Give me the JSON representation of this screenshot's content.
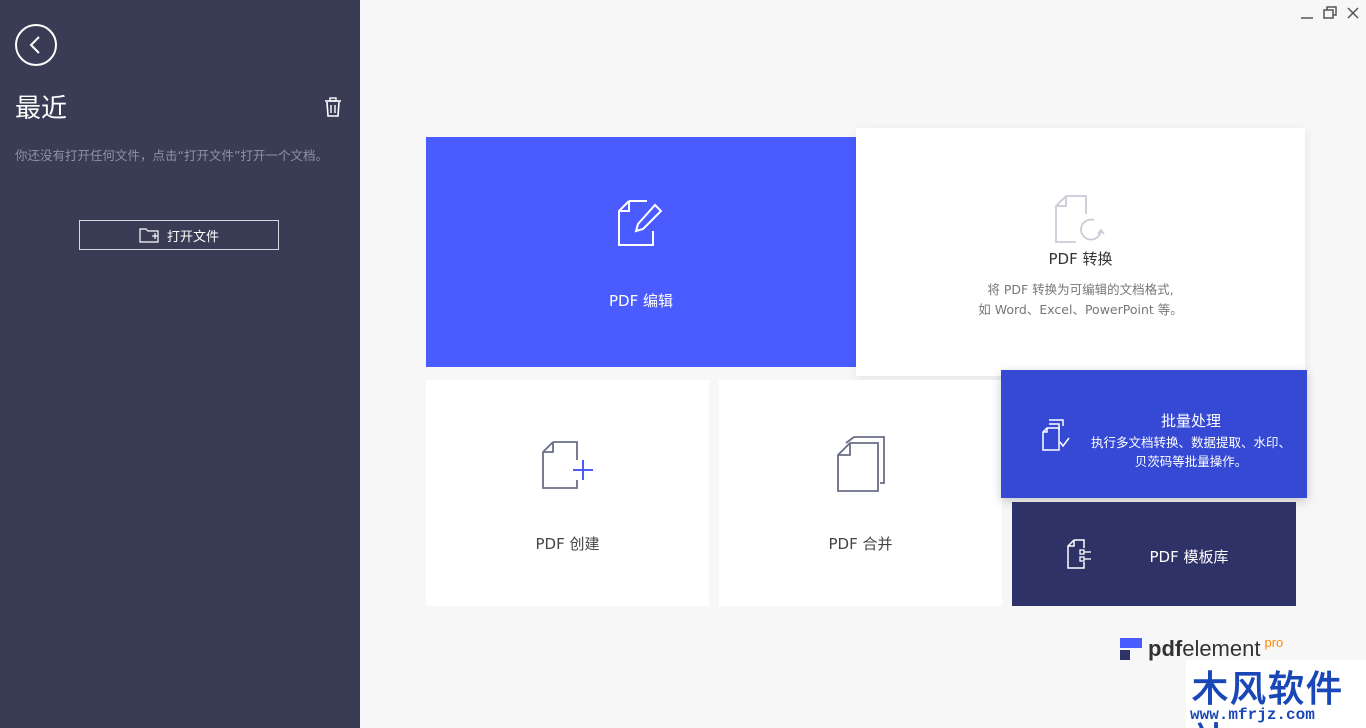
{
  "sidebar": {
    "title": "最近",
    "empty_message": "你还没有打开任何文件，点击“打开文件”打开一个文档。",
    "open_button": "打开文件"
  },
  "tiles": {
    "edit": {
      "label": "PDF 编辑"
    },
    "convert": {
      "label": "PDF 转换",
      "desc_line1": "将 PDF 转换为可编辑的文档格式,",
      "desc_line2": "如 Word、Excel、PowerPoint 等。"
    },
    "create": {
      "label": "PDF 创建"
    },
    "merge": {
      "label": "PDF 合并"
    },
    "batch": {
      "label": "批量处理",
      "desc_line1": "执行多文档转换、数据提取、水印、",
      "desc_line2": "贝茨码等批量操作。"
    },
    "template": {
      "label": "PDF 模板库"
    }
  },
  "logo": {
    "brand_bold": "pdf",
    "brand_rest": "element",
    "edition": "pro"
  },
  "watermark": {
    "title": "木风软件站",
    "url": "www.mfrjz.com"
  },
  "colors": {
    "sidebar": "#3a3c55",
    "edit": "#4a5cff",
    "batch": "#3549d4",
    "template": "#2e3266",
    "pro": "#ff8a00"
  }
}
